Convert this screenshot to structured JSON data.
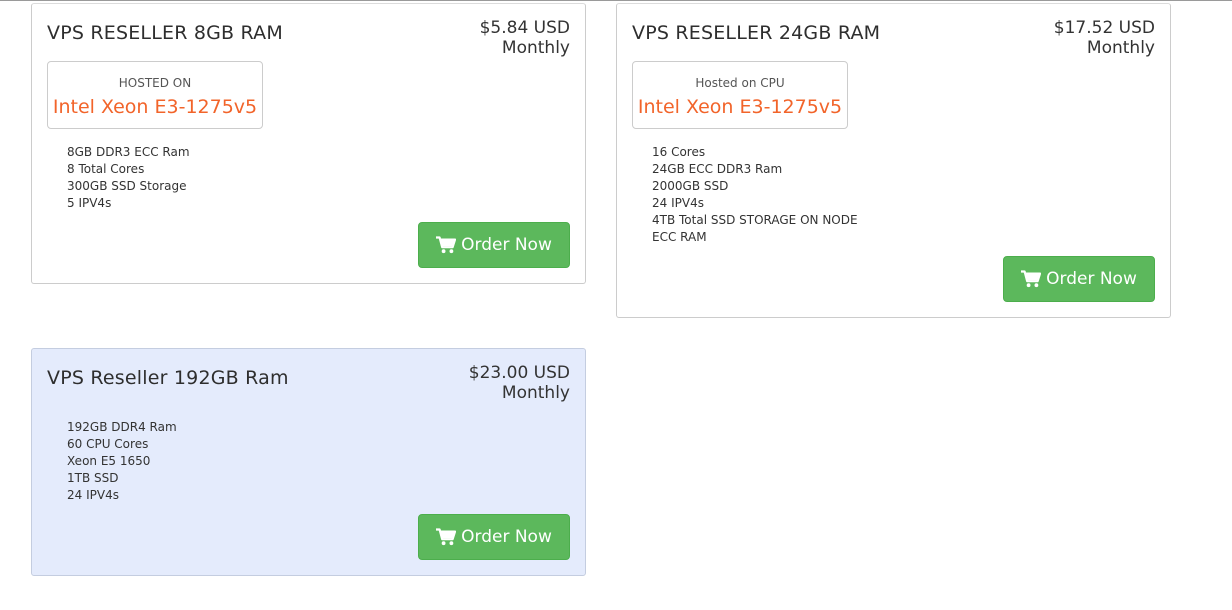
{
  "plans": [
    {
      "title": "VPS RESELLER 8GB RAM",
      "price": "$5.84 USD",
      "period": "Monthly",
      "hosted_label": "HOSTED ON",
      "hosted_cpu": "Intel Xeon E3-1275v5",
      "features": [
        "8GB DDR3 ECC Ram",
        "8 Total Cores",
        "300GB SSD Storage",
        "5 IPV4s"
      ],
      "order_label": "Order Now",
      "featured": false
    },
    {
      "title": "VPS RESELLER 24GB RAM",
      "price": "$17.52 USD",
      "period": "Monthly",
      "hosted_label": "Hosted on CPU",
      "hosted_cpu": "Intel Xeon E3-1275v5",
      "features": [
        "16 Cores",
        "24GB ECC DDR3 Ram",
        "2000GB SSD",
        "24 IPV4s",
        "4TB Total SSD STORAGE ON NODE",
        "ECC RAM"
      ],
      "order_label": "Order Now",
      "featured": false
    },
    {
      "title": "VPS Reseller 192GB Ram",
      "price": "$23.00 USD",
      "period": "Monthly",
      "features": [
        "192GB DDR4 Ram",
        "60 CPU Cores",
        "Xeon E5 1650",
        "1TB SSD",
        "24 IPV4s"
      ],
      "order_label": "Order Now",
      "featured": true
    }
  ],
  "icons": {
    "order": "shopping-cart-icon"
  },
  "colors": {
    "button": "#5cb85c",
    "cpu_accent": "#f2642a",
    "featured_bg": "#e4ebfc"
  }
}
